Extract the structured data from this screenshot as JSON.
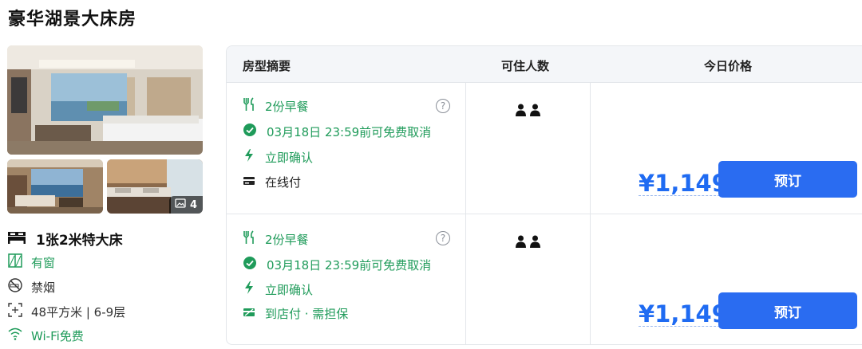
{
  "room": {
    "title": "豪华湖景大床房",
    "photo_count": "4",
    "bed": "1张2米特大床",
    "facilities": [
      {
        "label": "有窗",
        "icon": "window-icon",
        "tone": "green"
      },
      {
        "label": "禁烟",
        "icon": "no-smoking-icon",
        "tone": "gray"
      },
      {
        "label": "48平方米 | 6-9层",
        "icon": "area-icon",
        "tone": "gray"
      },
      {
        "label": "Wi-Fi免费",
        "icon": "wifi-icon",
        "tone": "green"
      }
    ]
  },
  "table": {
    "headers": {
      "summary": "房型摘要",
      "occupancy": "可住人数",
      "price": "今日价格"
    },
    "offers": [
      {
        "breakfast": "2份早餐",
        "cancel": "03月18日 23:59前可免费取消",
        "confirm": "立即确认",
        "payment": "在线付",
        "payment_icon": "credit-card-icon",
        "price": "¥1,149",
        "book_label": "预订"
      },
      {
        "breakfast": "2份早餐",
        "cancel": "03月18日 23:59前可免费取消",
        "confirm": "立即确认",
        "payment": "到店付 · 需担保",
        "payment_icon": "guarantee-card-icon",
        "price": "¥1,149",
        "book_label": "预订"
      }
    ]
  },
  "colors": {
    "accent": "#2a6cf1",
    "price": "#1f6bf2",
    "green": "#1f9b5a"
  }
}
